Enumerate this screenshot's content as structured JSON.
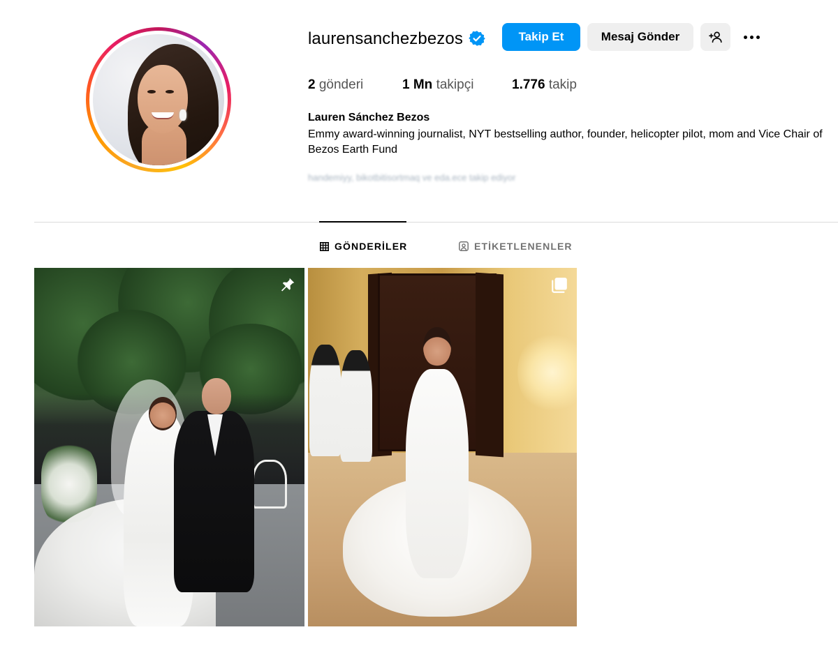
{
  "profile": {
    "username": "laurensanchezbezos",
    "verified": true,
    "full_name": "Lauren Sánchez Bezos",
    "bio": "Emmy award-winning journalist, NYT bestselling author, founder, helicopter pilot, mom and Vice Chair of Bezos Earth Fund",
    "followed_by": "handemiyy, bikotbitisortmaq ve eda.ece takip ediyor"
  },
  "actions": {
    "follow_label": "Takip Et",
    "message_label": "Mesaj Gönder",
    "add_user_icon": "person-plus-icon",
    "more_icon": "more-horizontal-icon"
  },
  "stats": {
    "posts_count": "2",
    "posts_label": "gönderi",
    "followers_count": "1 Mn",
    "followers_label": "takipçi",
    "following_count": "1.776",
    "following_label": "takip"
  },
  "tabs": [
    {
      "label": "GÖNDERİLER",
      "icon": "grid-icon",
      "active": true
    },
    {
      "label": "ETİKETLENENLER",
      "icon": "tagged-user-icon",
      "active": false
    }
  ],
  "posts": [
    {
      "description": "wedding-photo-outdoor",
      "overlay_icon": "pin-icon"
    },
    {
      "description": "wedding-photo-indoor",
      "overlay_icon": "carousel-icon"
    }
  ],
  "colors": {
    "primary_button": "#0095f6",
    "secondary_button": "#efefef",
    "verified_badge": "#0095f6",
    "muted_text": "#737373",
    "divider": "#dbdbdb"
  }
}
